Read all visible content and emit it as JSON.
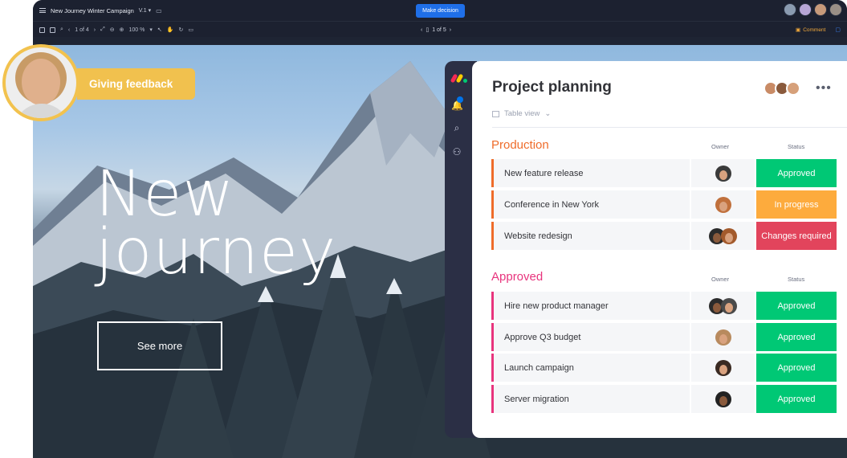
{
  "topbar": {
    "doc_title": "New Journey Winter Campaign",
    "version": "V.1",
    "decision_button": "Make decision"
  },
  "toolbar": {
    "page_nav": "1 of 4",
    "zoom": "100 %",
    "slide_nav": "1 of 5",
    "comment_label": "Comment"
  },
  "feedback": {
    "label": "Giving feedback"
  },
  "hero": {
    "title_line1": "New",
    "title_line2": "journey",
    "cta": "See more"
  },
  "board": {
    "title": "Project planning",
    "view": "Table view",
    "groups": [
      {
        "title": "Production",
        "color": "#ef6c2a",
        "owner_header": "Owner",
        "status_header": "Status",
        "rows": [
          {
            "name": "New feature release",
            "status": "Approved",
            "status_color": "#00c875"
          },
          {
            "name": "Conference in New York",
            "status": "In progress",
            "status_color": "#fdab3d"
          },
          {
            "name": "Website redesign",
            "status": "Changes required",
            "status_color": "#e2445c"
          }
        ]
      },
      {
        "title": "Approved",
        "color": "#e8347d",
        "owner_header": "Owner",
        "status_header": "Status",
        "rows": [
          {
            "name": "Hire new product manager",
            "status": "Approved",
            "status_color": "#00c875"
          },
          {
            "name": "Approve Q3 budget",
            "status": "Approved",
            "status_color": "#00c875"
          },
          {
            "name": "Launch campaign",
            "status": "Approved",
            "status_color": "#00c875"
          },
          {
            "name": "Server migration",
            "status": "Approved",
            "status_color": "#00c875"
          }
        ]
      }
    ]
  }
}
